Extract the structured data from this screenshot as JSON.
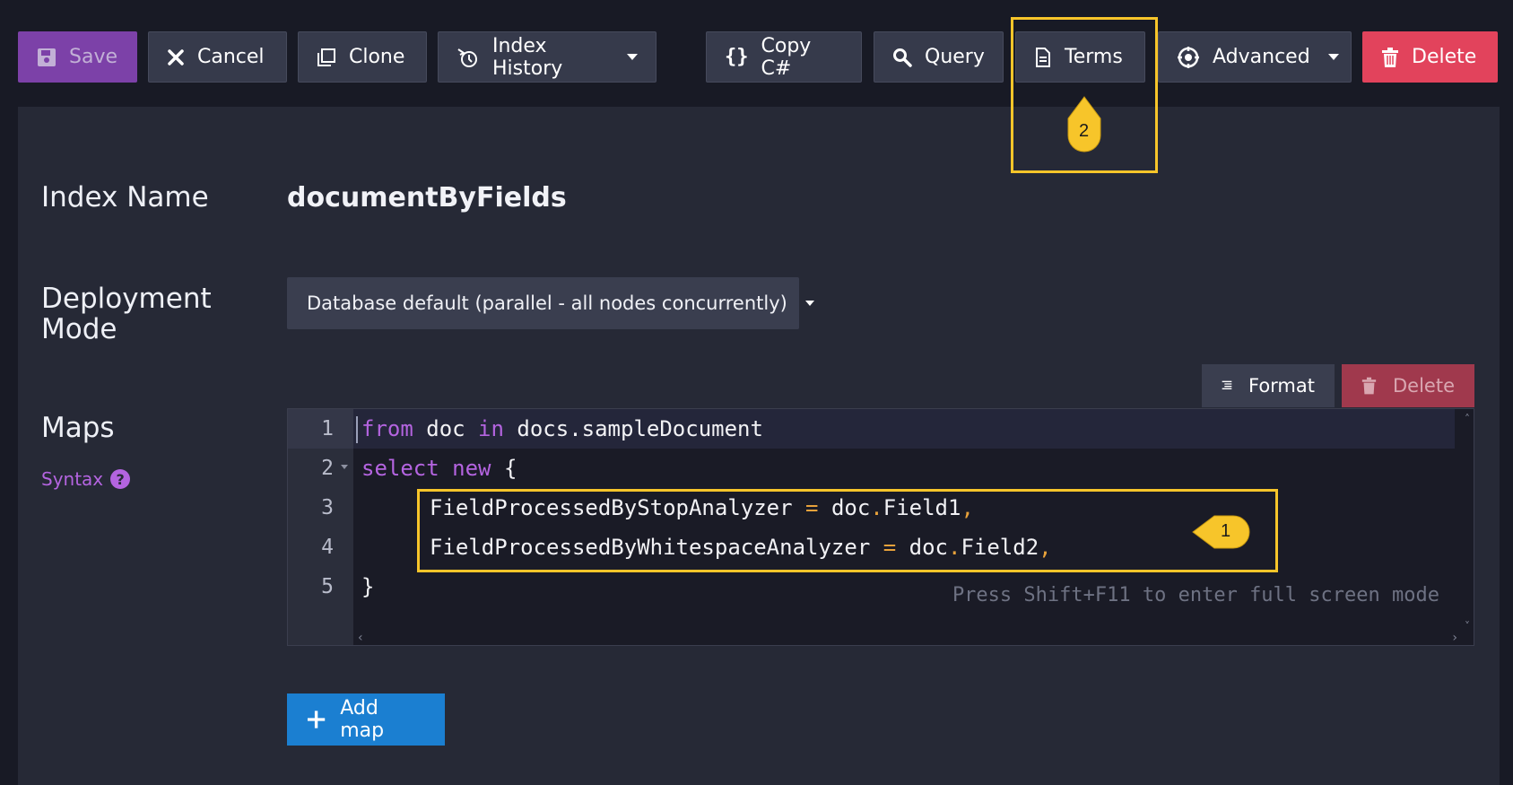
{
  "toolbar": {
    "save": "Save",
    "cancel": "Cancel",
    "clone": "Clone",
    "index_history": "Index History",
    "copy_csharp": "Copy C#",
    "query": "Query",
    "terms": "Terms",
    "advanced": "Advanced",
    "delete": "Delete"
  },
  "form": {
    "index_name_label": "Index Name",
    "index_name_value": "documentByFields",
    "deployment_label_line1": "Deployment",
    "deployment_label_line2": "Mode",
    "deployment_value": "Database default (parallel - all nodes concurrently)",
    "maps_label": "Maps",
    "syntax_link": "Syntax"
  },
  "map_toolbar": {
    "format": "Format",
    "delete": "Delete"
  },
  "editor": {
    "line_numbers": [
      "1",
      "2",
      "3",
      "4",
      "5"
    ],
    "line1": {
      "kw1": "from",
      "t1": " doc ",
      "kw2": "in",
      "t2": " docs.sampleDocument"
    },
    "line2": {
      "kw1": "select",
      "t1": " ",
      "kw2": "new",
      "t2": " {"
    },
    "line3": {
      "field": "FieldProcessedByStopAnalyzer",
      "eq": "=",
      "obj": "doc",
      "dot": ".",
      "prop": "Field1",
      "comma": ","
    },
    "line4": {
      "field": "FieldProcessedByWhitespaceAnalyzer",
      "eq": "=",
      "obj": "doc",
      "dot": ".",
      "prop": "Field2",
      "comma": ","
    },
    "line5": "}",
    "hint": "Press Shift+F11 to enter full screen mode"
  },
  "add_map": "Add map",
  "annotations": {
    "badge1": "1",
    "badge2": "2",
    "highlight_color": "#f7c52a"
  },
  "colors": {
    "background": "#181a25",
    "panel": "#262936",
    "save": "#7c41a8",
    "delete": "#e2435c",
    "primary": "#1b7fd1",
    "keyword": "#b464e0"
  }
}
